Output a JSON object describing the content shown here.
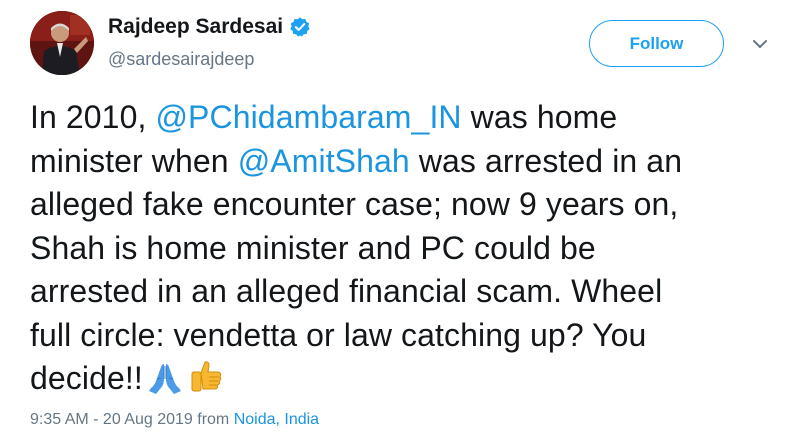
{
  "user": {
    "display_name": "Rajdeep Sardesai",
    "handle": "@sardesairajdeep",
    "verified": true
  },
  "actions": {
    "follow_label": "Follow"
  },
  "tweet": {
    "lines": [
      {
        "pre": "In 2010, ",
        "mention": "@PChidambaram_IN",
        "post": " was home"
      },
      {
        "pre": "minister when ",
        "mention": "@AmitShah",
        "post": " was arrested in an"
      },
      {
        "text": "alleged fake encounter case; now 9 years on,"
      },
      {
        "text": "Shah is home minister and PC could be"
      },
      {
        "text": "arrested in an alleged financial scam. Wheel"
      },
      {
        "text": "full circle: vendetta or law catching up? You"
      },
      {
        "text": "decide!!"
      }
    ],
    "emojis": [
      "folded-hands",
      "thumbs-up"
    ]
  },
  "meta": {
    "timestamp": "9:35 AM - 20 Aug 2019",
    "from_word": " from ",
    "location": "Noida, India"
  },
  "colors": {
    "accent": "#1da1f2",
    "link": "#1b95e0",
    "text": "#14171a",
    "muted": "#657786"
  }
}
